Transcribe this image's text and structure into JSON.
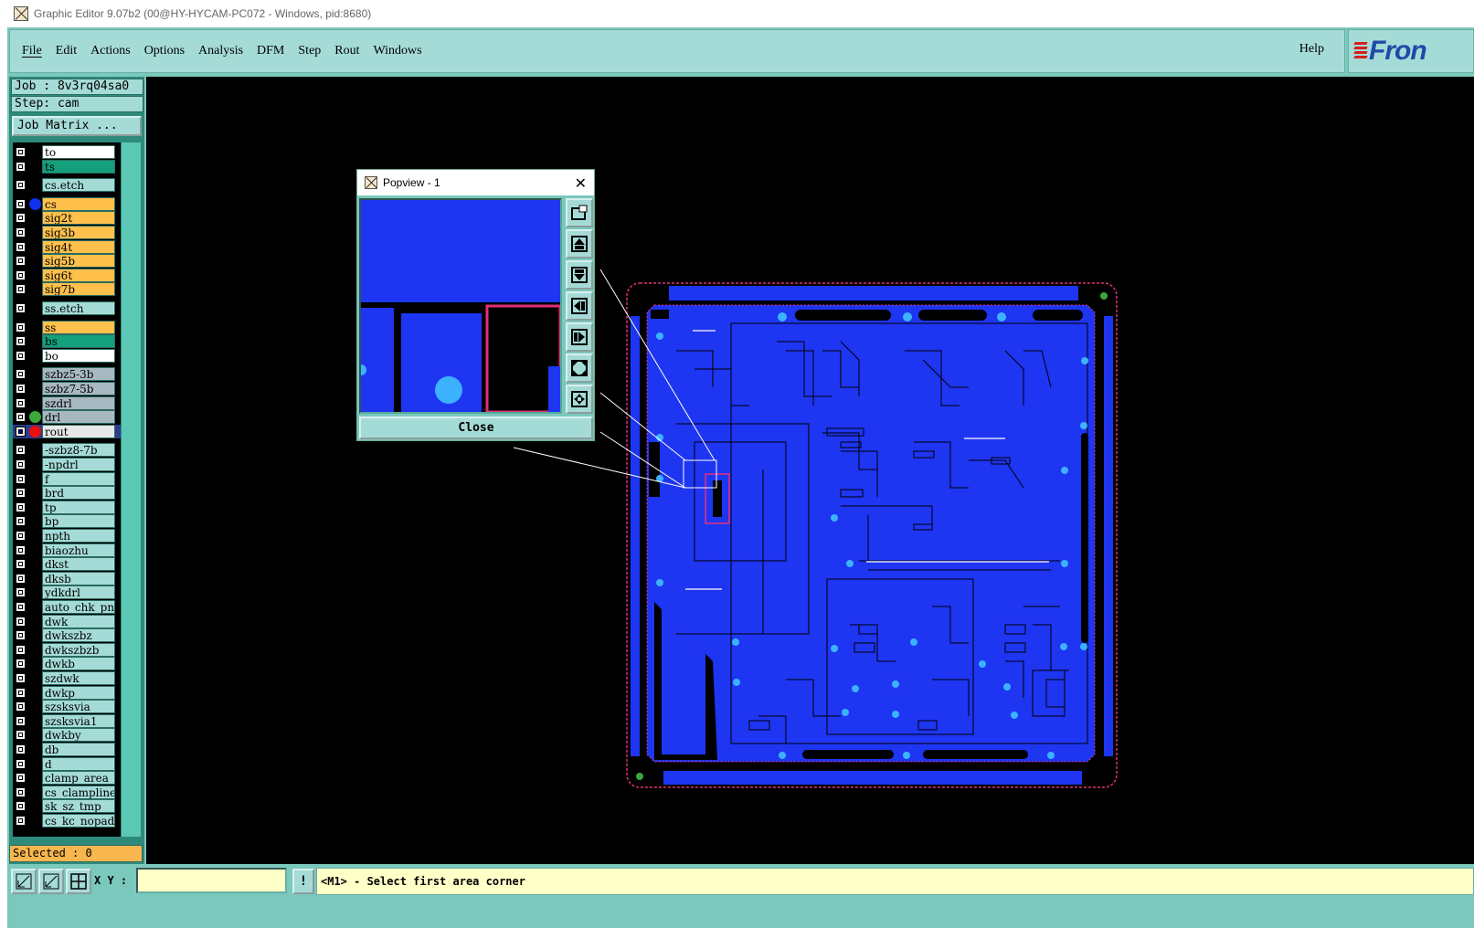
{
  "window": {
    "title": "Graphic Editor 9.07b2 (00@HY-HYCAM-PC072 - Windows, pid:8680)"
  },
  "menu": {
    "items": [
      "File",
      "Edit",
      "Actions",
      "Options",
      "Analysis",
      "DFM",
      "Step",
      "Rout",
      "Windows"
    ],
    "help": "Help",
    "logo": "Fron"
  },
  "job": {
    "job_line": "Job : 8v3rq04sa0",
    "step_line": "Step: cam",
    "matrix_button": "Job Matrix ..."
  },
  "colors": {
    "board_signal": "#ffc04c",
    "board_mask": "#00a070",
    "board_white": "#ffffff",
    "drill": "#a8b8c0",
    "misc": "#a5dbd7",
    "rout_red": "#e81010",
    "drl_green": "#3aa83a",
    "cs_blue": "#1030f0",
    "pcb_fill": "#1e35f2",
    "pcb_outline": "#e0307a"
  },
  "layers": [
    {
      "name": "to",
      "color": "#ffffff",
      "dot": ""
    },
    {
      "name": "ts",
      "color": "#14a07a",
      "dot": ""
    },
    {
      "name": "cs.etch",
      "color": "#a5dbd7",
      "dot": ""
    },
    {
      "name": "cs",
      "color": "#ffc04c",
      "dot": "#1030f0"
    },
    {
      "name": "sig2t",
      "color": "#ffc04c",
      "dot": ""
    },
    {
      "name": "sig3b",
      "color": "#ffc04c",
      "dot": ""
    },
    {
      "name": "sig4t",
      "color": "#ffc04c",
      "dot": ""
    },
    {
      "name": "sig5b",
      "color": "#ffc04c",
      "dot": ""
    },
    {
      "name": "sig6t",
      "color": "#ffc04c",
      "dot": ""
    },
    {
      "name": "sig7b",
      "color": "#ffc04c",
      "dot": ""
    },
    {
      "name": "ss.etch",
      "color": "#a5dbd7",
      "dot": ""
    },
    {
      "name": "ss",
      "color": "#ffc04c",
      "dot": ""
    },
    {
      "name": "bs",
      "color": "#14a07a",
      "dot": ""
    },
    {
      "name": "bo",
      "color": "#ffffff",
      "dot": ""
    },
    {
      "name": "szbz5-3b",
      "color": "#a8b8c0",
      "dot": ""
    },
    {
      "name": "szbz7-5b",
      "color": "#a8b8c0",
      "dot": ""
    },
    {
      "name": "szdrl",
      "color": "#a8b8c0",
      "dot": ""
    },
    {
      "name": "drl",
      "color": "#a8b8c0",
      "dot": "#3aa83a"
    },
    {
      "name": "rout",
      "color": "#e8e8e8",
      "dot": "#e81010",
      "selected": true
    },
    {
      "name": "-szbz8-7b",
      "color": "#a5dbd7",
      "dot": ""
    },
    {
      "name": "-npdrl",
      "color": "#a5dbd7",
      "dot": ""
    },
    {
      "name": "f",
      "color": "#a5dbd7",
      "dot": ""
    },
    {
      "name": "brd",
      "color": "#a5dbd7",
      "dot": ""
    },
    {
      "name": "tp",
      "color": "#a5dbd7",
      "dot": ""
    },
    {
      "name": "bp",
      "color": "#a5dbd7",
      "dot": ""
    },
    {
      "name": "npth",
      "color": "#a5dbd7",
      "dot": ""
    },
    {
      "name": "biaozhu",
      "color": "#a5dbd7",
      "dot": ""
    },
    {
      "name": "dkst",
      "color": "#a5dbd7",
      "dot": ""
    },
    {
      "name": "dksb",
      "color": "#a5dbd7",
      "dot": ""
    },
    {
      "name": "ydkdrl",
      "color": "#a5dbd7",
      "dot": ""
    },
    {
      "name": "auto_chk_pnl",
      "color": "#a5dbd7",
      "dot": ""
    },
    {
      "name": "dwk",
      "color": "#a5dbd7",
      "dot": ""
    },
    {
      "name": "dwkszbz",
      "color": "#a5dbd7",
      "dot": ""
    },
    {
      "name": "dwkszbzb",
      "color": "#a5dbd7",
      "dot": ""
    },
    {
      "name": "dwkb",
      "color": "#a5dbd7",
      "dot": ""
    },
    {
      "name": "szdwk",
      "color": "#a5dbd7",
      "dot": ""
    },
    {
      "name": "dwkp",
      "color": "#a5dbd7",
      "dot": ""
    },
    {
      "name": "szsksvia",
      "color": "#a5dbd7",
      "dot": ""
    },
    {
      "name": "szsksvia1",
      "color": "#a5dbd7",
      "dot": ""
    },
    {
      "name": "dwkby",
      "color": "#a5dbd7",
      "dot": ""
    },
    {
      "name": "db",
      "color": "#a5dbd7",
      "dot": ""
    },
    {
      "name": "d",
      "color": "#a5dbd7",
      "dot": ""
    },
    {
      "name": "clamp_area",
      "color": "#a5dbd7",
      "dot": ""
    },
    {
      "name": "cs_clampline",
      "color": "#a5dbd7",
      "dot": ""
    },
    {
      "name": "sk_sz_tmp",
      "color": "#a5dbd7",
      "dot": ""
    },
    {
      "name": "cs_kc_nopad",
      "color": "#a5dbd7",
      "dot": ""
    }
  ],
  "status": {
    "selected": "Selected : 0",
    "xy_label": "X Y :",
    "xy_value": "",
    "warn": "!",
    "message": "<M1> - Select first area corner"
  },
  "popview": {
    "title": "Popview - 1",
    "close_x": "✕",
    "close_button": "Close"
  }
}
